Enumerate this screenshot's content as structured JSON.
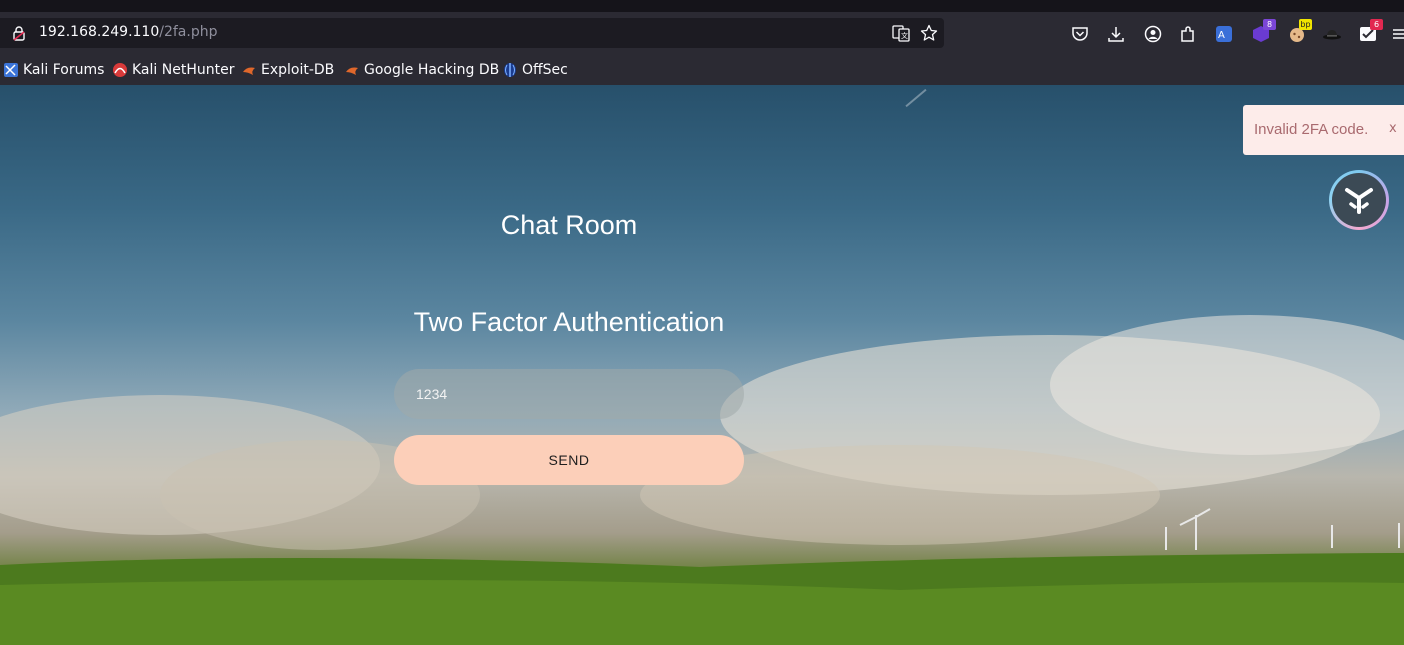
{
  "browser": {
    "url_host": "192.168.249.110",
    "url_path": "/2fa.php",
    "toolbar_badges": {
      "extension_count": "8",
      "bp_badge": "bp",
      "notification_count": "6"
    }
  },
  "bookmarks": [
    {
      "label": "Kali Forums",
      "icon": "kali-forums-icon"
    },
    {
      "label": "Kali NetHunter",
      "icon": "kali-nethunter-icon"
    },
    {
      "label": "Exploit-DB",
      "icon": "exploit-db-icon"
    },
    {
      "label": "Google Hacking DB",
      "icon": "ghdb-icon"
    },
    {
      "label": "OffSec",
      "icon": "offsec-icon"
    }
  ],
  "page": {
    "title": "Chat Room",
    "heading": "Two Factor Authentication",
    "code_input_value": "1234",
    "send_label": "SEND",
    "toast_message": "Invalid 2FA code.",
    "toast_close": "x"
  },
  "colors": {
    "send_button": "#fccfb9",
    "toast_bg": "#fdecea",
    "toast_text": "#a96a6f"
  }
}
